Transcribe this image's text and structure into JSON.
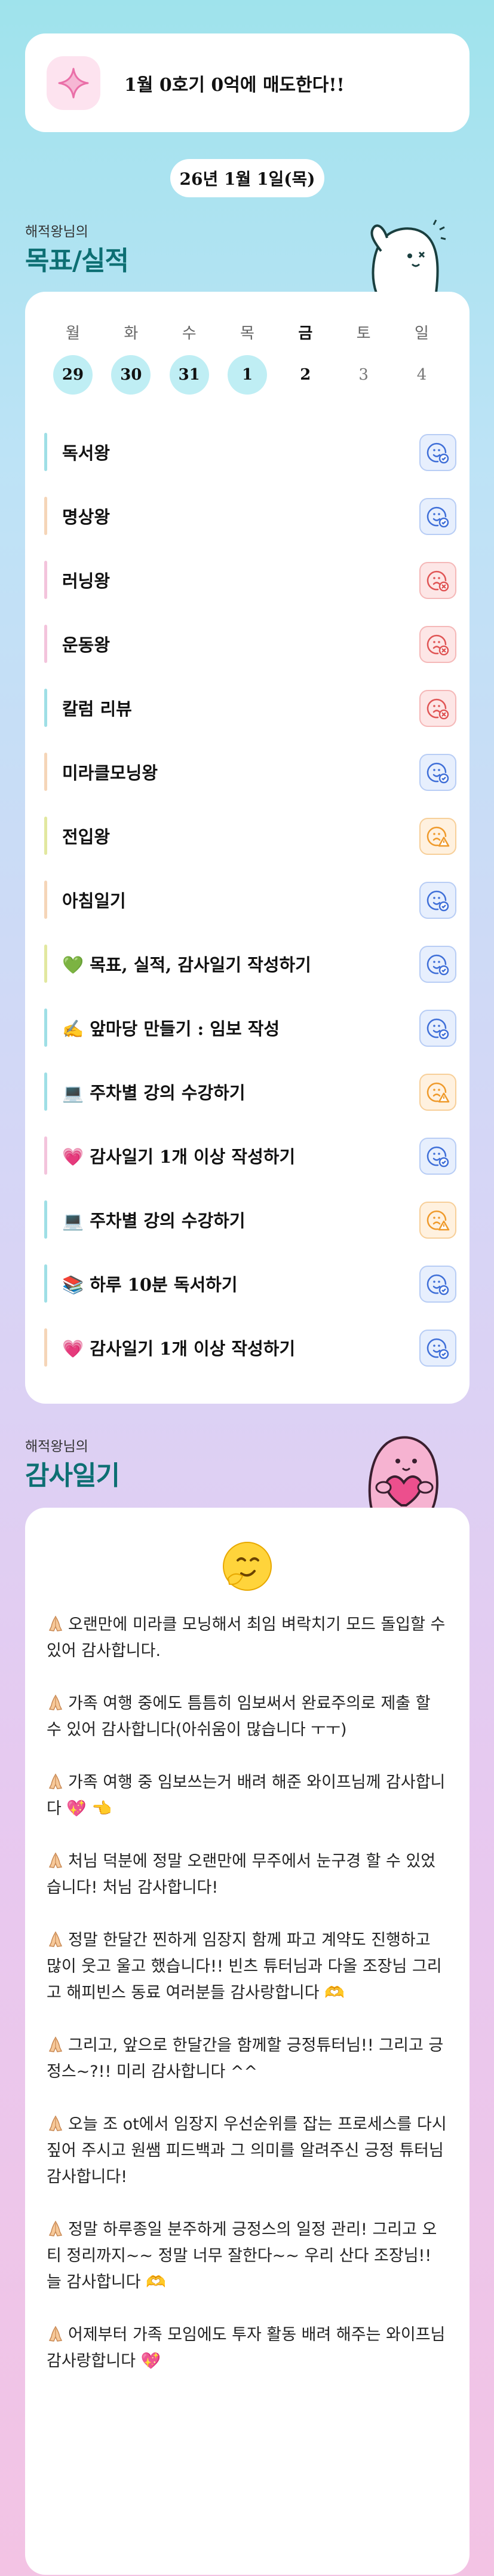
{
  "header": {
    "icon": "sparkle-icon",
    "text": "1월 0호기 0억에 매도한다!!"
  },
  "date_label": "26년 1월 1일(목)",
  "goals_section": {
    "subtitle": "해적왕님의",
    "title": "목표/실적"
  },
  "week": {
    "days": [
      {
        "label": "월",
        "num": "29",
        "state": "done"
      },
      {
        "label": "화",
        "num": "30",
        "state": "done"
      },
      {
        "label": "수",
        "num": "31",
        "state": "done"
      },
      {
        "label": "목",
        "num": "1",
        "state": "done"
      },
      {
        "label": "금",
        "num": "2",
        "state": "today"
      },
      {
        "label": "토",
        "num": "3",
        "state": "future"
      },
      {
        "label": "일",
        "num": "4",
        "state": "future"
      }
    ]
  },
  "goals": [
    {
      "title": "독서왕",
      "bar": "#9fdfe6",
      "status": "blue"
    },
    {
      "title": "명상왕",
      "bar": "#f5d5b8",
      "status": "blue"
    },
    {
      "title": "러닝왕",
      "bar": "#f3c4dc",
      "status": "red"
    },
    {
      "title": "운동왕",
      "bar": "#f3c4dc",
      "status": "red"
    },
    {
      "title": "칼럼 리뷰",
      "bar": "#9fdfe6",
      "status": "red"
    },
    {
      "title": "미라클모닝왕",
      "bar": "#f5d5b8",
      "status": "blue"
    },
    {
      "title": "전입왕",
      "bar": "#e2e8a0",
      "status": "orange"
    },
    {
      "title": "아침일기",
      "bar": "#f5d5b8",
      "status": "blue"
    },
    {
      "title": "💚 목표, 실적, 감사일기 작성하기",
      "bar": "#e2e8a0",
      "status": "blue"
    },
    {
      "title": "✍️ 앞마당 만들기 : 임보 작성",
      "bar": "#9fdfe6",
      "status": "blue"
    },
    {
      "title": "💻 주차별 강의 수강하기",
      "bar": "#9fdfe6",
      "status": "orange"
    },
    {
      "title": "💗 감사일기 1개 이상 작성하기",
      "bar": "#f3c4dc",
      "status": "blue"
    },
    {
      "title": "💻 주차별 강의 수강하기",
      "bar": "#9fdfe6",
      "status": "orange"
    },
    {
      "title": "📚 하루 10분 독서하기",
      "bar": "#9fdfe6",
      "status": "blue"
    },
    {
      "title": "💗 감사일기 1개 이상 작성하기",
      "bar": "#f5d5b8",
      "status": "blue"
    }
  ],
  "thanks_section": {
    "subtitle": "해적왕님의",
    "title": "감사일기"
  },
  "thanks": [
    "오랜만에 미라클 모닝해서 최임 벼락치기 모드 돌입할 수 있어 감사합니다.",
    "가족 여행 중에도 틈틈히 임보써서 완료주의로 제출 할 수 있어 감사합니다(아쉬움이 많습니다 ㅜㅜ)",
    "가족 여행 중 임보쓰는거 배려 해준 와이프님께 감사합니다 💖 👈",
    "처님 덕분에 정말 오랜만에 무주에서 눈구경 할 수 있었습니다! 처님 감사합니다!",
    "정말 한달간 찐하게 임장지 함께 파고 계약도 진행하고 많이 웃고 울고 했습니다!! 빈츠 튜터님과 다올 조장님 그리고 해피빈스 동료 여러분들 감사랑합니다 🫶",
    "그리고, 앞으로 한달간을 함께할 긍정튜터님!! 그리고 긍정스~?!! 미리 감사합니다 ^^",
    "오늘 조 ot에서 임장지 우선순위를 잡는 프로세스를 다시 짚어 주시고 원쌤 피드백과 그 의미를 알려주신 긍정 튜터님 감사합니다!",
    "정말 하루종일 분주하게 긍정스의 일정 관리! 그리고 오티 정리까지~~ 정말 너무 잘한다~~ 우리 산다 조장님!! 늘 감사합니다 🫶",
    "어제부터 가족 모임에도 투자 활동 배려 해주는 와이프님 감사랑합니다 💖"
  ],
  "colors": {
    "accent_teal": "#0d6f73",
    "done_day": "#bfeef4",
    "status_blue": "#3f6fd8",
    "status_red": "#e05555",
    "status_orange": "#ef9a2b"
  }
}
